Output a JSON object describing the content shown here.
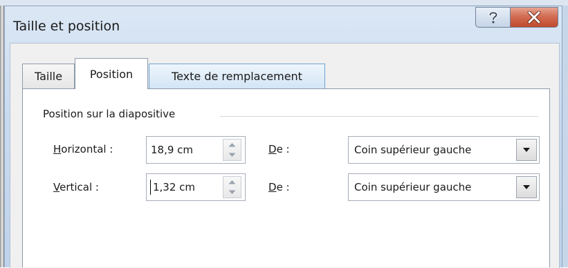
{
  "window": {
    "title": "Taille et position",
    "help_button": "?",
    "close_button": "X"
  },
  "tabs": [
    {
      "label": "Taille",
      "active": false
    },
    {
      "label": "Position",
      "active": true
    },
    {
      "label": "Texte de remplacement",
      "active": false
    }
  ],
  "group": {
    "title": "Position sur la diapositive"
  },
  "horizontal": {
    "label_access_key": "H",
    "label_rest": "orizontal :",
    "value": "18,9 cm",
    "from_label_access_key": "D",
    "from_label_rest": "e :",
    "from_value": "Coin supérieur gauche"
  },
  "vertical": {
    "label_access_key": "V",
    "label_rest": "ertical :",
    "value": "1,32 cm",
    "from_label_access_key": "D",
    "from_label_rest": "e :",
    "from_value": "Coin supérieur gauche"
  },
  "icons": {
    "help": "question-mark-icon",
    "close": "close-x-icon",
    "spin_up": "spin-up-arrow-icon",
    "spin_down": "spin-down-arrow-icon",
    "dropdown": "dropdown-arrow-icon"
  },
  "colors": {
    "title_bar": "#c8daf0",
    "close_button": "#c04a2d",
    "active_tab_hover_border": "#6ea2cf"
  }
}
